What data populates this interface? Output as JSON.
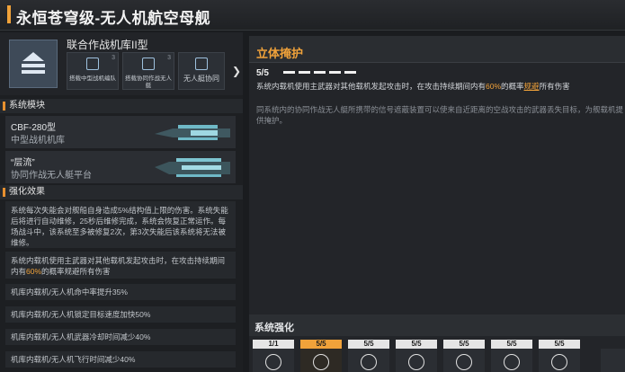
{
  "title": "永恒苍穹级-无人机航空母舰",
  "carrier": {
    "name": "联合作战机库II型",
    "sub_cards": [
      {
        "label": "搭载中型战机编队",
        "count": "3"
      },
      {
        "label": "搭载协同作战无人艇",
        "count": "3"
      },
      {
        "label": "无人艇协同",
        "count": ""
      }
    ]
  },
  "modules": {
    "section_title": "系统模块",
    "items": [
      {
        "name": "CBF-280型",
        "type": "中型战机机库"
      },
      {
        "name": "“层流”",
        "type": "协同作战无人艇平台"
      }
    ]
  },
  "effects": {
    "section_title": "强化效果",
    "block1": "系统每次失能会对舰船自身造成5%结构值上限的伤害。系统失能后将进行自动维修，25秒后维修完成，系统会恢复正常运作。每场战斗中，该系统至多被修复2次，第3次失能后该系统将无法被维修。",
    "block2_pre": "系统内载机使用主武器对其他载机发起攻击时，在攻击持续期间内有",
    "block2_hl": "60%",
    "block2_post": "的概率规避所有伤害",
    "rows": [
      "机库内载机/无人机命中率提升35%",
      "机库内载机/无人机锁定目标速度加快50%",
      "机库内载机/无人机武器冷却时间减少40%",
      "机库内载机/无人机飞行时间减少40%"
    ]
  },
  "skill": {
    "title": "立体掩护",
    "level": "5/5",
    "desc_pre": "系统内载机使用主武器对其他载机发起攻击时，在攻击持续期间内有",
    "desc_hl": "60%",
    "desc_mid": "的概率",
    "desc_hl2": "规避",
    "desc_post": "所有伤害",
    "extra": "同系统内的协同作战无人艇所携带的信号遮蔽装置可以使来自近距离的空战攻击的武器丢失目标，为舰载机提供掩护。"
  },
  "enhancement": {
    "title": "系统强化",
    "slots": [
      "1/1",
      "5/5",
      "5/5",
      "5/5",
      "5/5",
      "5/5",
      "5/5"
    ]
  },
  "colors": {
    "accent": "#f0a23a",
    "bg": "#1a1c1f"
  }
}
